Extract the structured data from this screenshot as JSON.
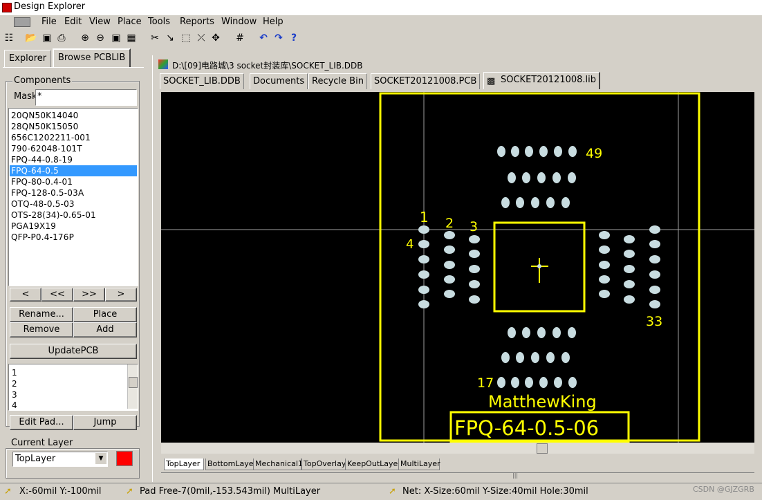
{
  "app": {
    "title": "Design Explorer"
  },
  "menu": [
    "File",
    "Edit",
    "View",
    "Place",
    "Tools",
    "Reports",
    "Window",
    "Help"
  ],
  "left_panel": {
    "tabs": [
      "Explorer",
      "Browse PCBLIB"
    ],
    "components_label": "Components",
    "mask_label": "Mask",
    "mask_value": "*",
    "components": [
      "20QN50K14040",
      "28QN50K15050",
      "656C1202211-001",
      "790-62048-101T",
      "FPQ-44-0.8-19",
      "FPQ-64-0.5",
      "FPQ-80-0.4-01",
      "FPQ-128-0.5-03A",
      "OTQ-48-0.5-03",
      "OTS-28(34)-0.65-01",
      "PGA19X19",
      "QFP-P0.4-176P"
    ],
    "selected_index": 5,
    "nav_buttons": [
      "<",
      "<<",
      ">>",
      ">"
    ],
    "rename_button": "Rename...",
    "place_button": "Place",
    "remove_button": "Remove",
    "add_button": "Add",
    "update_button": "UpdatePCB",
    "pads": [
      "1",
      "2",
      "3",
      "4"
    ],
    "edit_pad_button": "Edit Pad...",
    "jump_button": "Jump",
    "current_layer_label": "Current Layer",
    "current_layer_value": "TopLayer",
    "layer_color": "#ff0000"
  },
  "document": {
    "path": "D:\\[09]电路城\\3 socket封装库\\SOCKET_LIB.DDB",
    "tabs": [
      "SOCKET_LIB.DDB",
      "Documents",
      "Recycle Bin",
      "SOCKET20121008.PCB",
      "SOCKET20121008.lib"
    ],
    "active_tab": 4,
    "layer_tabs": [
      "TopLayer",
      "BottomLayer",
      "Mechanical1",
      "TopOverlay",
      "KeepOutLayer",
      "MultiLayer"
    ]
  },
  "footprint": {
    "pin_labels": {
      "p1": "1",
      "p2": "2",
      "p3": "3",
      "p4": "4",
      "p17": "17",
      "p33": "33",
      "p49": "49"
    },
    "designer_text": "MatthewKing",
    "part_name": "FPQ-64-0.5-06",
    "colors": {
      "background": "#000000",
      "outline": "#ffff00",
      "pad": "#c8dce0",
      "grid": "#a0a0a0"
    }
  },
  "status": {
    "coords": "X:-60mil Y:-100mil",
    "pad_info": "Pad Free-7(0mil,-153.543mil)  MultiLayer",
    "net_info": "Net: X-Size:60mil Y-Size:40mil Hole:30mil",
    "watermark": "CSDN @GJZGRB"
  }
}
